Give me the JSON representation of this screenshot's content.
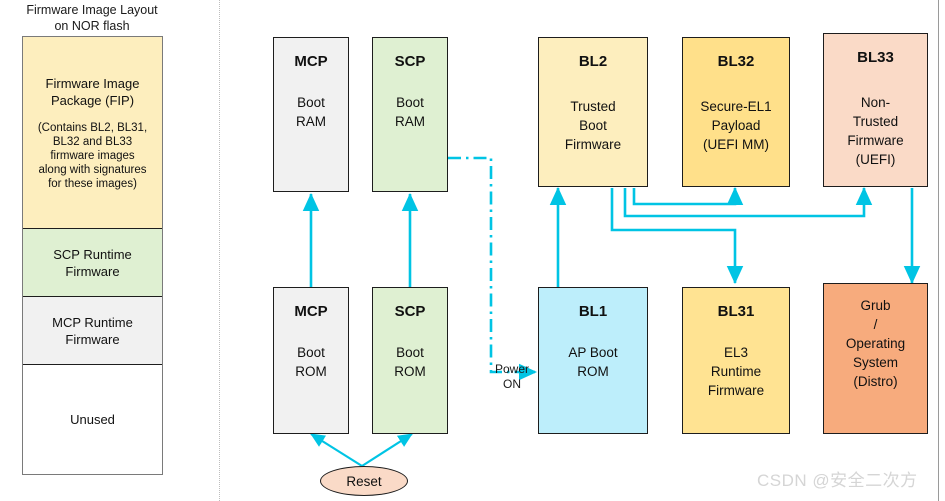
{
  "colors": {
    "arrow": "#00c4e4",
    "fip_fill": "#fdeebe",
    "scp_fill": "#dff0d2",
    "mcp_fill": "#f1f1f1",
    "unused_fill": "#ffffff",
    "bl2_fill": "#fdeebe",
    "bl32_fill": "#ffe08a",
    "bl33_fill": "#fadac7",
    "bl1_fill": "#bdeefb",
    "bl31_fill": "#ffe392",
    "grub_fill": "#f7ab7d",
    "reset_fill": "#fadac7",
    "border": "#1d1d1d",
    "watermark": "#d5d5d5"
  },
  "left_panel": {
    "title_line1": "Firmware Image Layout",
    "title_line2": "on NOR flash",
    "segments": [
      {
        "name": "fip",
        "main": "Firmware Image\nPackage (FIP)",
        "sub": "(Contains BL2, BL31,\nBL32 and BL33\nfirmware images\nalong with signatures\nfor these images)"
      },
      {
        "name": "scp-runtime",
        "main": "SCP Runtime\nFirmware",
        "sub": ""
      },
      {
        "name": "mcp-runtime",
        "main": "MCP Runtime\nFirmware",
        "sub": ""
      },
      {
        "name": "unused",
        "main": "Unused",
        "sub": ""
      }
    ]
  },
  "nodes": {
    "mcp_boot_ram": {
      "title": "MCP",
      "body": "Boot\nRAM"
    },
    "scp_boot_ram": {
      "title": "SCP",
      "body": "Boot\nRAM"
    },
    "bl2": {
      "title": "BL2",
      "body": "Trusted\nBoot\nFirmware"
    },
    "bl32": {
      "title": "BL32",
      "body": "Secure-EL1\nPayload\n(UEFI MM)"
    },
    "bl33": {
      "title": "BL33",
      "body": "Non-\nTrusted\nFirmware\n(UEFI)"
    },
    "mcp_boot_rom": {
      "title": "MCP",
      "body": "Boot\nROM"
    },
    "scp_boot_rom": {
      "title": "SCP",
      "body": "Boot\nROM"
    },
    "bl1": {
      "title": "BL1",
      "body": "AP Boot\nROM"
    },
    "bl31": {
      "title": "BL31",
      "body": "EL3\nRuntime\nFirmware"
    },
    "grub": {
      "title": "",
      "body": "Grub\n/\nOperating\nSystem\n(Distro)"
    }
  },
  "reset": {
    "label": "Reset"
  },
  "labels": {
    "power_on": "Power\nON"
  },
  "watermark": {
    "text": "CSDN @安全二次方"
  },
  "footer": {
    "text": ""
  }
}
